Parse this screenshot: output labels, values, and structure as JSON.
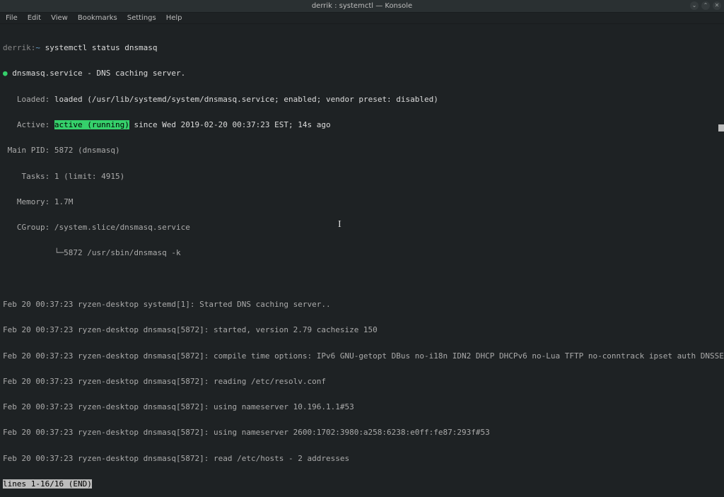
{
  "titlebar": {
    "title": "derrik : systemctl — Konsole"
  },
  "window_controls": {
    "minimize": "⌄",
    "maximize": "⌃",
    "close": "✕"
  },
  "menubar": {
    "items": [
      "File",
      "Edit",
      "View",
      "Bookmarks",
      "Settings",
      "Help"
    ]
  },
  "prompt": {
    "user_host": "derrik:",
    "path": "~",
    "symbol": " "
  },
  "command": "systemctl status dnsmasq",
  "status": {
    "service_line": "dnsmasq.service - DNS caching server.",
    "loaded_label": "   Loaded: ",
    "loaded_value": "loaded (/usr/lib/systemd/system/dnsmasq.service; enabled; vendor preset: disabled)",
    "active_label": "   Active: ",
    "active_value": "active (running)",
    "active_rest": " since Wed 2019-02-20 00:37:23 EST; 14s ago",
    "main_pid": " Main PID: 5872 (dnsmasq)",
    "tasks": "    Tasks: 1 (limit: 4915)",
    "memory": "   Memory: 1.7M",
    "cgroup": "   CGroup: /system.slice/dnsmasq.service",
    "cgroup2": "           └─5872 /usr/sbin/dnsmasq -k"
  },
  "logs": [
    "Feb 20 00:37:23 ryzen-desktop systemd[1]: Started DNS caching server..",
    "Feb 20 00:37:23 ryzen-desktop dnsmasq[5872]: started, version 2.79 cachesize 150",
    "Feb 20 00:37:23 ryzen-desktop dnsmasq[5872]: compile time options: IPv6 GNU-getopt DBus no-i18n IDN2 DHCP DHCPv6 no-Lua TFTP no-conntrack ipset auth DNSSEC loop-detect inot",
    "Feb 20 00:37:23 ryzen-desktop dnsmasq[5872]: reading /etc/resolv.conf",
    "Feb 20 00:37:23 ryzen-desktop dnsmasq[5872]: using nameserver 10.196.1.1#53",
    "Feb 20 00:37:23 ryzen-desktop dnsmasq[5872]: using nameserver 2600:1702:3980:a258:6238:e0ff:fe87:293f#53",
    "Feb 20 00:37:23 ryzen-desktop dnsmasq[5872]: read /etc/hosts - 2 addresses"
  ],
  "pager": "lines 1-16/16 (END)"
}
